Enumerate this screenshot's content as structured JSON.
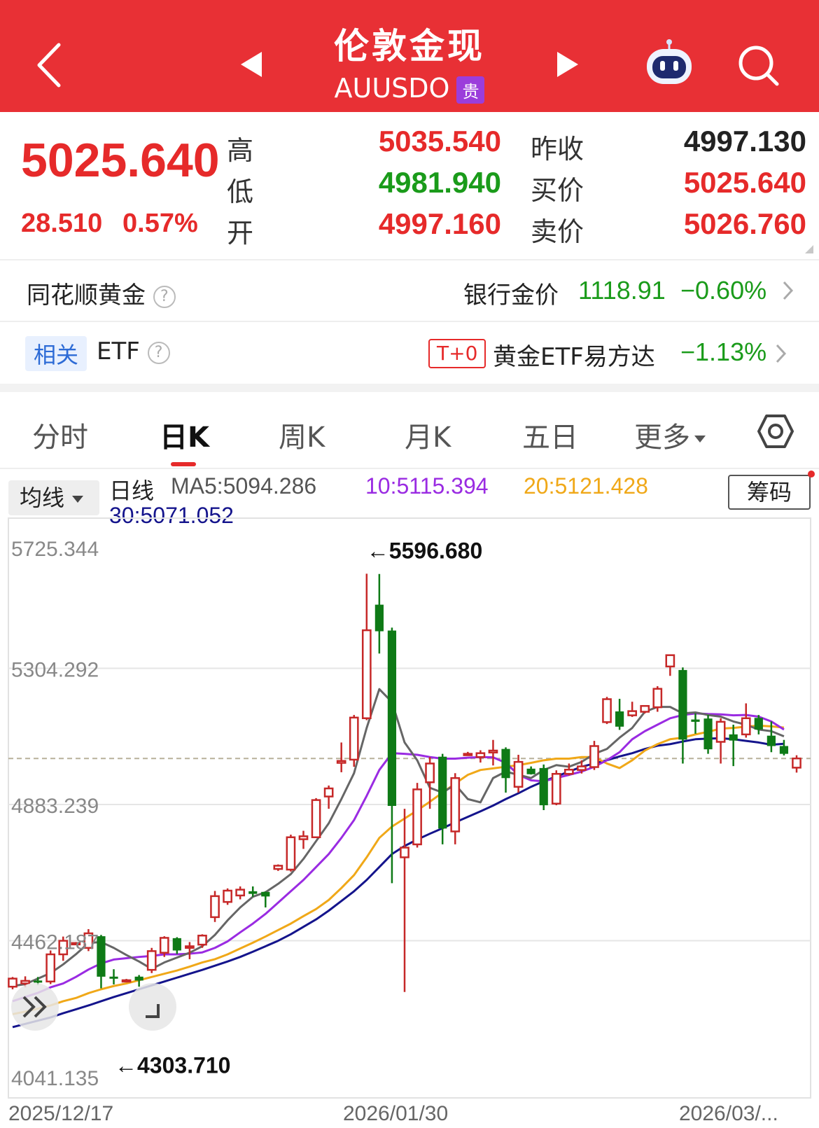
{
  "header": {
    "title": "伦敦金现",
    "symbol": "AUUSDO",
    "badge": "贵"
  },
  "quote": {
    "price": "5025.640",
    "change": "28.510",
    "change_pct": "0.57%",
    "high_label": "高",
    "high": "5035.540",
    "low_label": "低",
    "low": "4981.940",
    "open_label": "开",
    "open": "4997.160",
    "prev_close_label": "昨收",
    "prev_close": "4997.130",
    "bid_label": "买价",
    "bid": "5025.640",
    "ask_label": "卖价",
    "ask": "5026.760"
  },
  "gold_row": {
    "label": "同花顺黄金",
    "bank_label": "银行金价",
    "bank_price": "1118.91",
    "bank_change": "−0.60%"
  },
  "etf_row": {
    "tag": "相关",
    "label": "ETF",
    "t0": "T+0",
    "name": "黄金ETF易方达",
    "change": "−1.13%"
  },
  "tabs": [
    "分时",
    "日K",
    "周K",
    "月K",
    "五日",
    "更多"
  ],
  "active_tab": 1,
  "indicator": {
    "select_label": "均线",
    "line_label": "日线",
    "ma5": "MA5:5094.286",
    "ma10": "10:5115.394",
    "ma20": "20:5121.428",
    "ma30": "30:5071.052",
    "chip_button": "筹码"
  },
  "colors": {
    "up": "#c62828",
    "down": "#0e7a16",
    "ma5": "#666666",
    "ma10": "#9a2be2",
    "ma20": "#f0a818",
    "ma30": "#14148c",
    "header": "#e83035"
  },
  "chart_data": {
    "type": "candlestick",
    "y_ticks": [
      "5725.344",
      "5304.292",
      "4883.239",
      "4462.187",
      "4041.135"
    ],
    "ylim": [
      4041.135,
      5725.344
    ],
    "x_labels": [
      "2025/12/17",
      "2026/01/30",
      "2026/03/..."
    ],
    "high_annotation": "←5596.680",
    "low_annotation": "←4303.710",
    "last_close_line": 5025.64,
    "candles": [
      {
        "o": 4320,
        "c": 4345,
        "h": 4350,
        "l": 4312
      },
      {
        "o": 4330,
        "c": 4338,
        "h": 4352,
        "l": 4318
      },
      {
        "o": 4338,
        "c": 4336,
        "h": 4350,
        "l": 4325
      },
      {
        "o": 4336,
        "c": 4420,
        "h": 4432,
        "l": 4328
      },
      {
        "o": 4420,
        "c": 4462,
        "h": 4475,
        "l": 4400
      },
      {
        "o": 4455,
        "c": 4455,
        "h": 4458,
        "l": 4449
      },
      {
        "o": 4440,
        "c": 4485,
        "h": 4498,
        "l": 4430
      },
      {
        "o": 4475,
        "c": 4352,
        "h": 4480,
        "l": 4315
      },
      {
        "o": 4350,
        "c": 4348,
        "h": 4374,
        "l": 4327
      },
      {
        "o": 4340,
        "c": 4340,
        "h": 4344,
        "l": 4336
      },
      {
        "o": 4350,
        "c": 4340,
        "h": 4356,
        "l": 4320
      },
      {
        "o": 4372,
        "c": 4430,
        "h": 4440,
        "l": 4362
      },
      {
        "o": 4425,
        "c": 4471,
        "h": 4476,
        "l": 4412
      },
      {
        "o": 4469,
        "c": 4433,
        "h": 4473,
        "l": 4421
      },
      {
        "o": 4440,
        "c": 4445,
        "h": 4458,
        "l": 4405
      },
      {
        "o": 4450,
        "c": 4478,
        "h": 4482,
        "l": 4440
      },
      {
        "o": 4535,
        "c": 4600,
        "h": 4616,
        "l": 4520
      },
      {
        "o": 4582,
        "c": 4617,
        "h": 4624,
        "l": 4573
      },
      {
        "o": 4602,
        "c": 4620,
        "h": 4630,
        "l": 4590
      },
      {
        "o": 4614,
        "c": 4608,
        "h": 4630,
        "l": 4598
      },
      {
        "o": 4612,
        "c": 4600,
        "h": 4614,
        "l": 4565
      },
      {
        "o": 4684,
        "c": 4694,
        "h": 4698,
        "l": 4678
      },
      {
        "o": 4682,
        "c": 4782,
        "h": 4790,
        "l": 4676
      },
      {
        "o": 4776,
        "c": 4785,
        "h": 4802,
        "l": 4746
      },
      {
        "o": 4782,
        "c": 4897,
        "h": 4903,
        "l": 4780
      },
      {
        "o": 4908,
        "c": 4933,
        "h": 4942,
        "l": 4870
      },
      {
        "o": 5012,
        "c": 5018,
        "h": 5075,
        "l": 4983
      },
      {
        "o": 5022,
        "c": 5152,
        "h": 5160,
        "l": 5000
      },
      {
        "o": 5150,
        "c": 5422,
        "h": 5596.68,
        "l": 5144
      },
      {
        "o": 5500,
        "c": 5420,
        "h": 5596,
        "l": 5350
      },
      {
        "o": 5420,
        "c": 4880,
        "h": 5430,
        "l": 4640
      },
      {
        "o": 4720,
        "c": 4750,
        "h": 4870,
        "l": 4303.71
      },
      {
        "o": 4760,
        "c": 4930,
        "h": 4950,
        "l": 4750
      },
      {
        "o": 4952,
        "c": 5010,
        "h": 5030,
        "l": 4870
      },
      {
        "o": 5030,
        "c": 4810,
        "h": 5040,
        "l": 4760
      },
      {
        "o": 4800,
        "c": 4965,
        "h": 4980,
        "l": 4760
      },
      {
        "o": 5040,
        "c": 5040,
        "h": 5046,
        "l": 5034
      },
      {
        "o": 5030,
        "c": 5042,
        "h": 5051,
        "l": 5013
      },
      {
        "o": 5044,
        "c": 5050,
        "h": 5083,
        "l": 5004
      },
      {
        "o": 5054,
        "c": 4966,
        "h": 5060,
        "l": 4920
      },
      {
        "o": 4938,
        "c": 5015,
        "h": 5037,
        "l": 4920
      },
      {
        "o": 4993,
        "c": 4978,
        "h": 5001,
        "l": 4976
      },
      {
        "o": 4995,
        "c": 4882,
        "h": 5007,
        "l": 4866
      },
      {
        "o": 4886,
        "c": 4978,
        "h": 4989,
        "l": 4881
      },
      {
        "o": 4978,
        "c": 4991,
        "h": 5010,
        "l": 4973
      },
      {
        "o": 4990,
        "c": 5001,
        "h": 5020,
        "l": 4979
      },
      {
        "o": 4999,
        "c": 5064,
        "h": 5080,
        "l": 4990
      },
      {
        "o": 5138,
        "c": 5209,
        "h": 5216,
        "l": 5132
      },
      {
        "o": 5170,
        "c": 5125,
        "h": 5210,
        "l": 5114
      },
      {
        "o": 5159,
        "c": 5172,
        "h": 5201,
        "l": 5154
      },
      {
        "o": 5170,
        "c": 5188,
        "h": 5190,
        "l": 5165
      },
      {
        "o": 5184,
        "c": 5241,
        "h": 5249,
        "l": 5170
      },
      {
        "o": 5310,
        "c": 5345,
        "h": 5346,
        "l": 5281
      },
      {
        "o": 5298,
        "c": 5085,
        "h": 5307,
        "l": 5010
      },
      {
        "o": 5145,
        "c": 5140,
        "h": 5165,
        "l": 5102
      },
      {
        "o": 5148,
        "c": 5055,
        "h": 5160,
        "l": 5040
      },
      {
        "o": 5077,
        "c": 5139,
        "h": 5150,
        "l": 5010
      },
      {
        "o": 5099,
        "c": 5082,
        "h": 5130,
        "l": 5002
      },
      {
        "o": 5100,
        "c": 5150,
        "h": 5196,
        "l": 5090
      },
      {
        "o": 5150,
        "c": 5116,
        "h": 5160,
        "l": 5100
      },
      {
        "o": 5095,
        "c": 5065,
        "h": 5140,
        "l": 5045
      },
      {
        "o": 5063,
        "c": 5041,
        "h": 5083,
        "l": 5035
      },
      {
        "o": 4997.16,
        "c": 5025.64,
        "h": 5035.54,
        "l": 4981.94
      }
    ],
    "ma5": [
      4322,
      4328,
      4345,
      4362,
      4389,
      4420,
      4455,
      4458,
      4440,
      4418,
      4398,
      4375,
      4395,
      4410,
      4425,
      4445,
      4480,
      4525,
      4565,
      4598,
      4612,
      4638,
      4668,
      4715,
      4770,
      4825,
      4900,
      4980,
      5120,
      5240,
      5200,
      5075,
      5020,
      4935,
      4920,
      4945,
      4900,
      4890,
      4965,
      4985,
      4975,
      4965,
      4990,
      5005,
      5000,
      5015,
      5040,
      5055,
      5090,
      5120,
      5170,
      5185,
      5185,
      5165,
      5168,
      5160,
      5155,
      5140,
      5130,
      5115,
      5110,
      5094
    ],
    "ma10": [
      4275,
      4288,
      4301,
      4318,
      4330,
      4350,
      4373,
      4392,
      4404,
      4408,
      4412,
      4415,
      4420,
      4420,
      4422,
      4426,
      4440,
      4460,
      4488,
      4515,
      4545,
      4580,
      4615,
      4650,
      4690,
      4730,
      4780,
      4835,
      4910,
      4990,
      5042,
      5040,
      5037,
      5030,
      5025,
      5025,
      5028,
      5030,
      5029,
      5012,
      4975,
      4958,
      4955,
      4965,
      4975,
      4985,
      5000,
      5020,
      5045,
      5085,
      5110,
      5130,
      5150,
      5160,
      5165,
      5163,
      5162,
      5159,
      5160,
      5155,
      5140,
      5115
    ],
    "ma20": [
      4235,
      4243,
      4252,
      4262,
      4275,
      4285,
      4300,
      4312,
      4322,
      4330,
      4340,
      4350,
      4360,
      4370,
      4382,
      4395,
      4405,
      4420,
      4438,
      4456,
      4475,
      4495,
      4515,
      4538,
      4560,
      4588,
      4625,
      4665,
      4720,
      4780,
      4815,
      4840,
      4865,
      4892,
      4920,
      4948,
      4975,
      4990,
      4995,
      5000,
      5005,
      5012,
      5020,
      5025,
      5025,
      5030,
      5030,
      5010,
      4996,
      5020,
      5050,
      5070,
      5085,
      5090,
      5100,
      5108,
      5118,
      5120,
      5124,
      5127,
      5125,
      5121
    ],
    "ma30": [
      4195,
      4205,
      4215,
      4225,
      4238,
      4250,
      4262,
      4275,
      4288,
      4300,
      4312,
      4324,
      4336,
      4348,
      4360,
      4372,
      4385,
      4398,
      4412,
      4428,
      4445,
      4462,
      4482,
      4505,
      4528,
      4555,
      4585,
      4615,
      4650,
      4690,
      4730,
      4755,
      4775,
      4793,
      4810,
      4828,
      4845,
      4862,
      4880,
      4900,
      4918,
      4938,
      4955,
      4970,
      4985,
      5000,
      5010,
      5020,
      5032,
      5042,
      5055,
      5065,
      5070,
      5078,
      5085,
      5087,
      5088,
      5085,
      5080,
      5075,
      5068,
      5071
    ]
  }
}
